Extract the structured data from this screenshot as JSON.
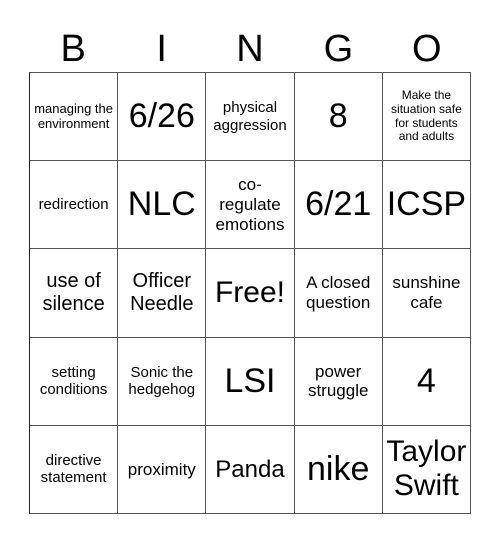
{
  "card": {
    "header": [
      "B",
      "I",
      "N",
      "G",
      "O"
    ],
    "rows": [
      [
        {
          "text": "managing the environment",
          "size": "fs-s"
        },
        {
          "text": "6/26",
          "size": "fs-huge"
        },
        {
          "text": "physical aggression",
          "size": "fs-m"
        },
        {
          "text": "8",
          "size": "fs-huge"
        },
        {
          "text": "Make the situation safe for students and adults",
          "size": "fs-xs"
        }
      ],
      [
        {
          "text": "redirection",
          "size": "fs-m"
        },
        {
          "text": "NLC",
          "size": "fs-huge"
        },
        {
          "text": "co-regulate emotions",
          "size": "fs-ml"
        },
        {
          "text": "6/21",
          "size": "fs-huge"
        },
        {
          "text": "ICSP",
          "size": "fs-huge"
        }
      ],
      [
        {
          "text": "use of silence",
          "size": "fs-l"
        },
        {
          "text": "Officer Needle",
          "size": "fs-l"
        },
        {
          "text": "Free!",
          "size": "fs-xxl"
        },
        {
          "text": "A closed question",
          "size": "fs-ml"
        },
        {
          "text": "sunshine cafe",
          "size": "fs-ml"
        }
      ],
      [
        {
          "text": "setting conditions",
          "size": "fs-m"
        },
        {
          "text": "Sonic the hedgehog",
          "size": "fs-m"
        },
        {
          "text": "LSI",
          "size": "fs-huge"
        },
        {
          "text": "power struggle",
          "size": "fs-ml"
        },
        {
          "text": "4",
          "size": "fs-huge"
        }
      ],
      [
        {
          "text": "directive statement",
          "size": "fs-m"
        },
        {
          "text": "proximity",
          "size": "fs-ml"
        },
        {
          "text": "Panda",
          "size": "fs-xl"
        },
        {
          "text": "nike",
          "size": "fs-huge"
        },
        {
          "text": "Taylor Swift",
          "size": "fs-xxl"
        }
      ]
    ]
  },
  "colors": {
    "background": "#ffffff",
    "text": "#000000",
    "grid": "#555555"
  }
}
